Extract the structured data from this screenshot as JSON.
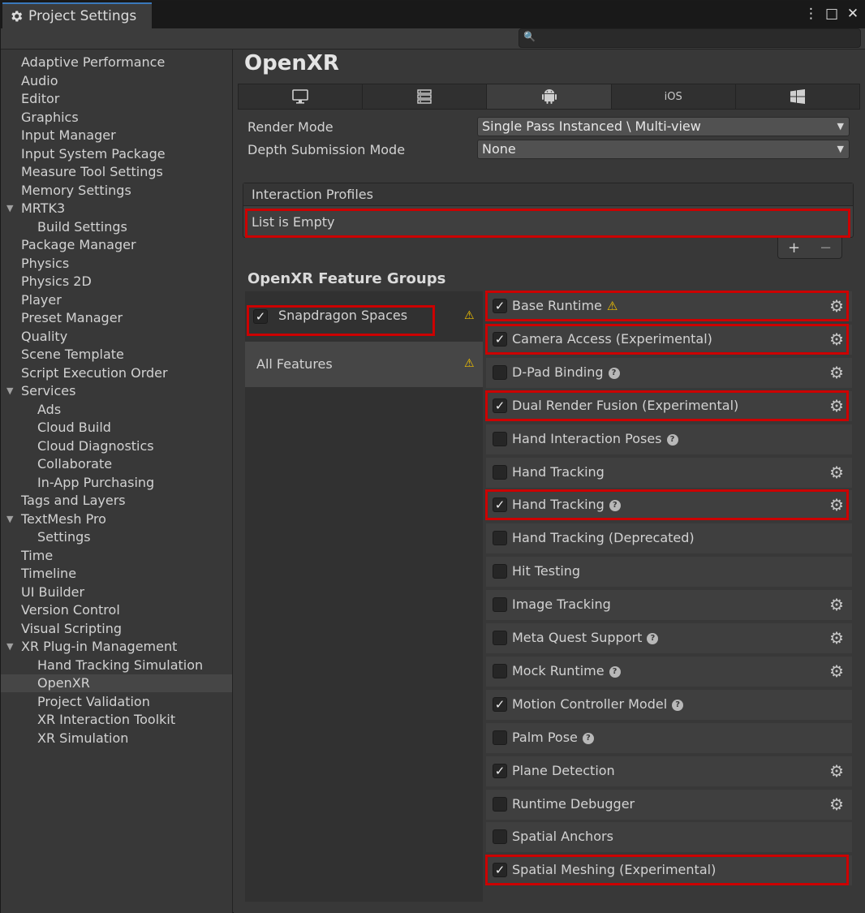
{
  "window": {
    "title": "Project Settings",
    "controls": [
      "⋮",
      "□",
      "✕"
    ]
  },
  "search": {
    "placeholder": ""
  },
  "sidebar": {
    "items": [
      {
        "label": "Adaptive Performance",
        "indent": 0
      },
      {
        "label": "Audio",
        "indent": 0
      },
      {
        "label": "Editor",
        "indent": 0
      },
      {
        "label": "Graphics",
        "indent": 0
      },
      {
        "label": "Input Manager",
        "indent": 0
      },
      {
        "label": "Input System Package",
        "indent": 0
      },
      {
        "label": "Measure Tool Settings",
        "indent": 0
      },
      {
        "label": "Memory Settings",
        "indent": 0
      },
      {
        "label": "MRTK3",
        "indent": 0,
        "expanded": true
      },
      {
        "label": "Build Settings",
        "indent": 1
      },
      {
        "label": "Package Manager",
        "indent": 0
      },
      {
        "label": "Physics",
        "indent": 0
      },
      {
        "label": "Physics 2D",
        "indent": 0
      },
      {
        "label": "Player",
        "indent": 0
      },
      {
        "label": "Preset Manager",
        "indent": 0
      },
      {
        "label": "Quality",
        "indent": 0
      },
      {
        "label": "Scene Template",
        "indent": 0
      },
      {
        "label": "Script Execution Order",
        "indent": 0
      },
      {
        "label": "Services",
        "indent": 0,
        "expanded": true
      },
      {
        "label": "Ads",
        "indent": 1
      },
      {
        "label": "Cloud Build",
        "indent": 1
      },
      {
        "label": "Cloud Diagnostics",
        "indent": 1
      },
      {
        "label": "Collaborate",
        "indent": 1
      },
      {
        "label": "In-App Purchasing",
        "indent": 1
      },
      {
        "label": "Tags and Layers",
        "indent": 0
      },
      {
        "label": "TextMesh Pro",
        "indent": 0,
        "expanded": true
      },
      {
        "label": "Settings",
        "indent": 1
      },
      {
        "label": "Time",
        "indent": 0
      },
      {
        "label": "Timeline",
        "indent": 0
      },
      {
        "label": "UI Builder",
        "indent": 0
      },
      {
        "label": "Version Control",
        "indent": 0
      },
      {
        "label": "Visual Scripting",
        "indent": 0
      },
      {
        "label": "XR Plug-in Management",
        "indent": 0,
        "expanded": true
      },
      {
        "label": "Hand Tracking Simulation",
        "indent": 1
      },
      {
        "label": "OpenXR",
        "indent": 1,
        "selected": true
      },
      {
        "label": "Project Validation",
        "indent": 1
      },
      {
        "label": "XR Interaction Toolkit",
        "indent": 1
      },
      {
        "label": "XR Simulation",
        "indent": 1
      }
    ]
  },
  "main": {
    "title": "OpenXR",
    "platform_tabs": [
      {
        "icon": "desktop-icon",
        "label": ""
      },
      {
        "icon": "server-icon",
        "label": ""
      },
      {
        "icon": "android-icon",
        "label": "",
        "active": true
      },
      {
        "icon": "ios-icon",
        "label": "iOS"
      },
      {
        "icon": "windows-icon",
        "label": ""
      }
    ],
    "render_mode_label": "Render Mode",
    "render_mode_value": "Single Pass Instanced \\ Multi-view",
    "depth_mode_label": "Depth Submission Mode",
    "depth_mode_value": "None",
    "interaction_profiles_label": "Interaction Profiles",
    "interaction_profiles_empty": "List is Empty",
    "add_label": "+",
    "remove_label": "−",
    "feature_groups_title": "OpenXR Feature Groups",
    "groups": [
      {
        "label": "Snapdragon Spaces",
        "checked": true,
        "warning": true
      },
      {
        "label": "All Features",
        "warning": true
      }
    ],
    "features": [
      {
        "label": "Base Runtime",
        "checked": true,
        "help": false,
        "warn": true,
        "gear": true
      },
      {
        "label": "Camera Access (Experimental)",
        "checked": true,
        "help": false,
        "gear": true
      },
      {
        "label": "D-Pad Binding",
        "checked": false,
        "help": true,
        "gear": true
      },
      {
        "label": "Dual Render Fusion (Experimental)",
        "checked": true,
        "help": false,
        "gear": true
      },
      {
        "label": "Hand Interaction Poses",
        "checked": false,
        "help": true,
        "gear": false
      },
      {
        "label": "Hand Tracking",
        "checked": false,
        "help": false,
        "gear": true
      },
      {
        "label": "Hand Tracking",
        "checked": true,
        "help": true,
        "gear": true
      },
      {
        "label": "Hand Tracking (Deprecated)",
        "checked": false,
        "help": false,
        "gear": false
      },
      {
        "label": "Hit Testing",
        "checked": false,
        "help": false,
        "gear": false
      },
      {
        "label": "Image Tracking",
        "checked": false,
        "help": false,
        "gear": true
      },
      {
        "label": "Meta Quest Support",
        "checked": false,
        "help": true,
        "gear": true
      },
      {
        "label": "Mock Runtime",
        "checked": false,
        "help": true,
        "gear": true
      },
      {
        "label": "Motion Controller Model",
        "checked": true,
        "help": true,
        "gear": false
      },
      {
        "label": "Palm Pose",
        "checked": false,
        "help": true,
        "gear": false
      },
      {
        "label": "Plane Detection",
        "checked": true,
        "help": false,
        "gear": true
      },
      {
        "label": "Runtime Debugger",
        "checked": false,
        "help": false,
        "gear": true
      },
      {
        "label": "Spatial Anchors",
        "checked": false,
        "help": false,
        "gear": false
      },
      {
        "label": "Spatial Meshing (Experimental)",
        "checked": true,
        "help": false,
        "gear": false
      }
    ]
  },
  "colors": {
    "highlight": "#cc0000",
    "warning": "#f0c000",
    "accent_tab": "#3a79bb"
  }
}
